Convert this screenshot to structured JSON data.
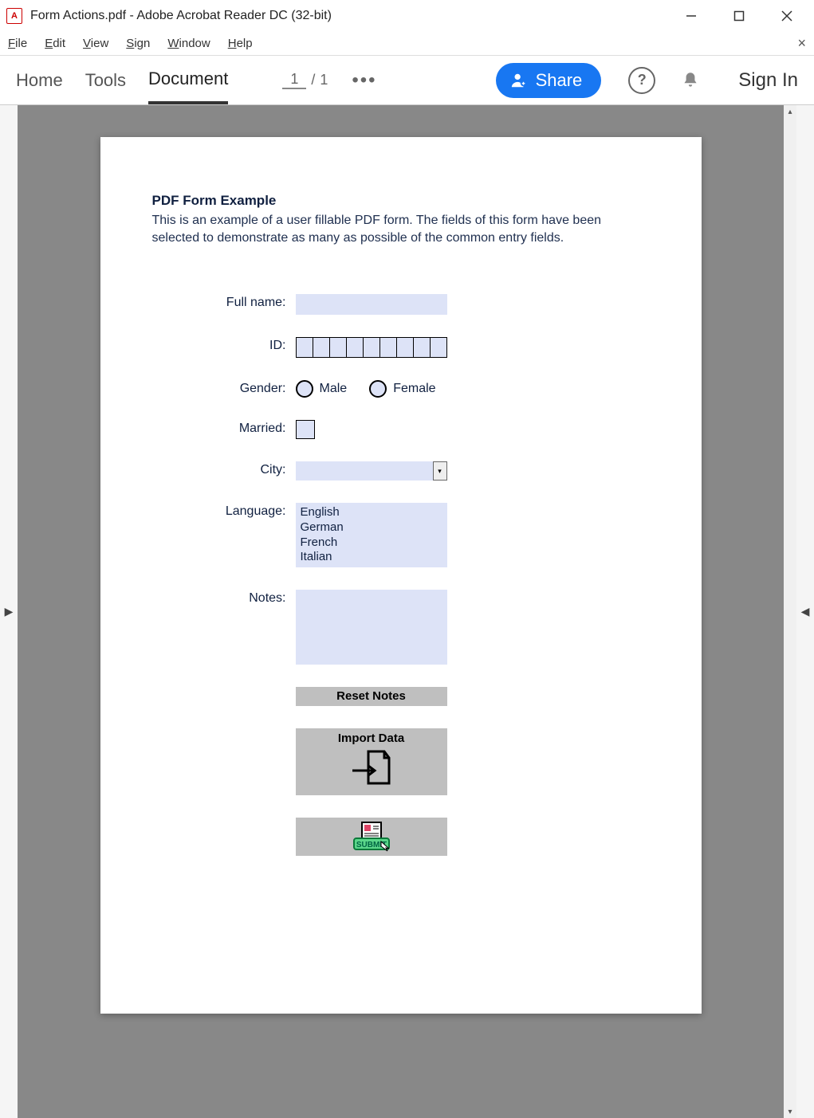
{
  "window": {
    "title": "Form Actions.pdf - Adobe Acrobat Reader DC (32-bit)"
  },
  "menubar": {
    "file": "File",
    "edit": "Edit",
    "view": "View",
    "sign": "Sign",
    "window": "Window",
    "help": "Help"
  },
  "toolbar": {
    "home": "Home",
    "tools": "Tools",
    "document": "Document",
    "current_page": "1",
    "page_sep": "/",
    "total_pages": "1",
    "share": "Share",
    "signin": "Sign In"
  },
  "form": {
    "title": "PDF Form Example",
    "description": "This is an example of a user fillable PDF form. The fields of this form have been selected to demonstrate as many as possible of the common entry fields.",
    "labels": {
      "fullname": "Full name:",
      "id": "ID:",
      "gender": "Gender:",
      "married": "Married:",
      "city": "City:",
      "language": "Language:",
      "notes": "Notes:"
    },
    "gender": {
      "male": "Male",
      "female": "Female"
    },
    "languages": [
      "English",
      "German",
      "French",
      "Italian"
    ],
    "buttons": {
      "reset": "Reset Notes",
      "import": "Import Data",
      "submit": "SUBMIT"
    }
  }
}
